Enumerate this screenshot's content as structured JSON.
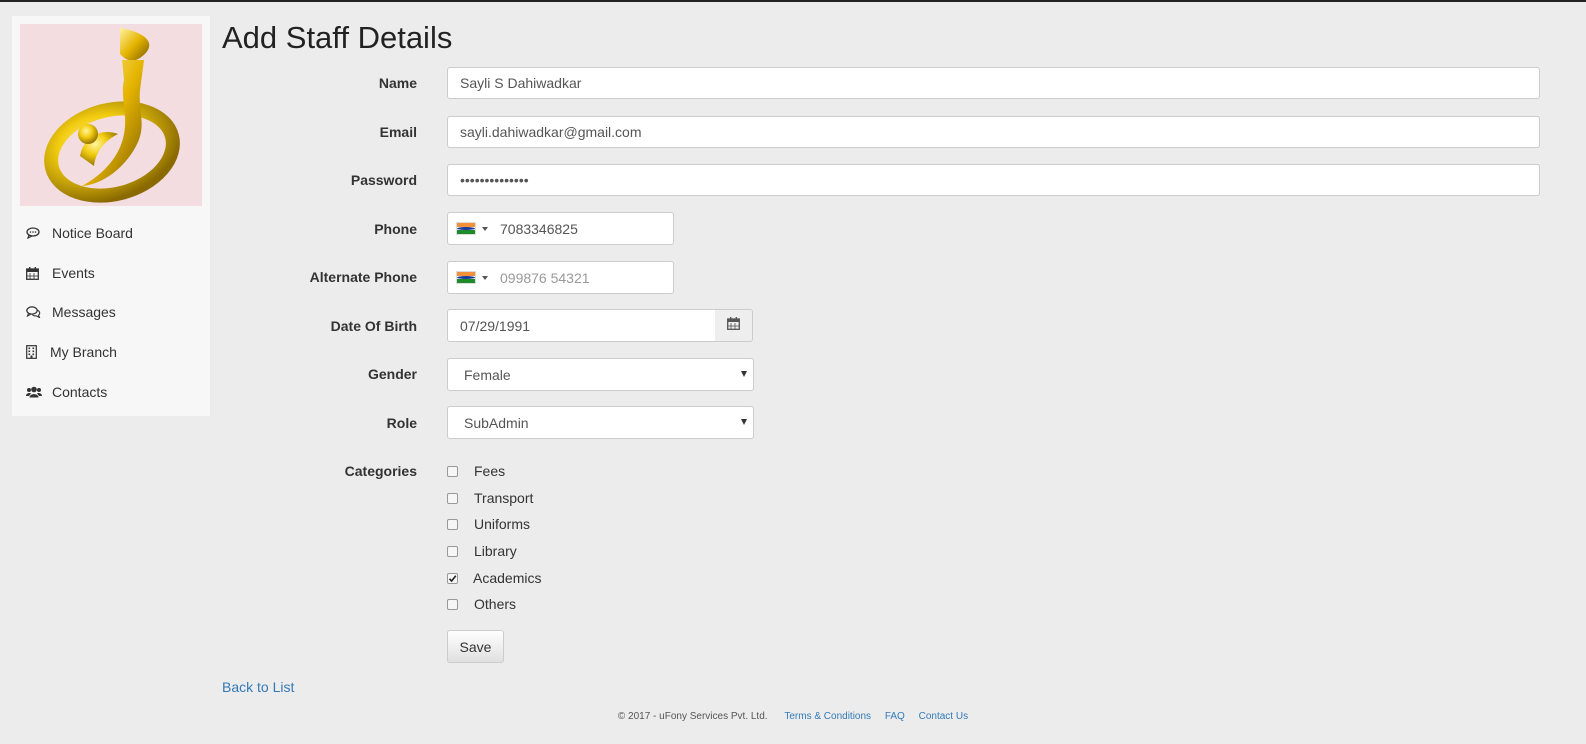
{
  "sidebar": {
    "items": [
      {
        "label": "Notice Board",
        "icon": "comment-icon"
      },
      {
        "label": "Events",
        "icon": "calendar-icon"
      },
      {
        "label": "Messages",
        "icon": "comments-icon"
      },
      {
        "label": "My Branch",
        "icon": "building-icon"
      },
      {
        "label": "Contacts",
        "icon": "users-icon"
      }
    ]
  },
  "page": {
    "title": "Add Staff Details"
  },
  "form": {
    "name": {
      "label": "Name",
      "value": "Sayli S Dahiwadkar"
    },
    "email": {
      "label": "Email",
      "value": "sayli.dahiwadkar@gmail.com"
    },
    "password": {
      "label": "Password",
      "value": "••••••••••••••"
    },
    "phone": {
      "label": "Phone",
      "value": "7083346825",
      "country": "India"
    },
    "alt_phone": {
      "label": "Alternate Phone",
      "value": "",
      "placeholder": "099876 54321",
      "country": "India"
    },
    "dob": {
      "label": "Date Of Birth",
      "value": "07/29/1991"
    },
    "gender": {
      "label": "Gender",
      "selected": "Female"
    },
    "role": {
      "label": "Role",
      "selected": "SubAdmin"
    },
    "categories": {
      "label": "Categories",
      "options": [
        {
          "label": "Fees",
          "checked": false
        },
        {
          "label": "Transport",
          "checked": false
        },
        {
          "label": "Uniforms",
          "checked": false
        },
        {
          "label": "Library",
          "checked": false
        },
        {
          "label": "Academics",
          "checked": true
        },
        {
          "label": "Others",
          "checked": false
        }
      ]
    },
    "save_label": "Save"
  },
  "back_link": "Back to List",
  "footer": {
    "copyright": "© 2017 - uFony Services Pvt. Ltd.",
    "links": [
      "Terms & Conditions",
      "FAQ",
      "Contact Us"
    ]
  },
  "colors": {
    "background": "#ececec",
    "link": "#337ab7",
    "logo_gold": "#e0b800"
  }
}
